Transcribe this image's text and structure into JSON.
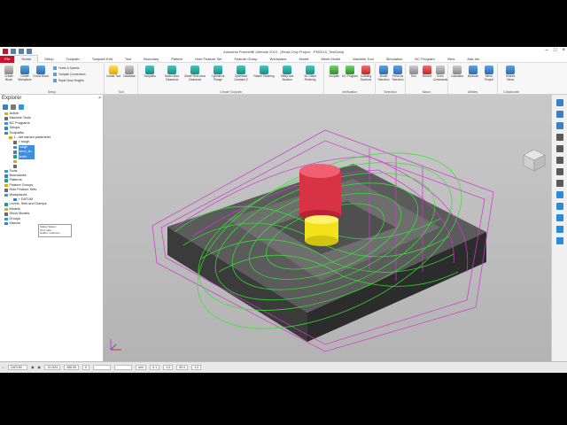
{
  "window": {
    "title": "Autodesk PowerMill Ultimate 2019  - [Read-Only Project - PM2019_TestData]",
    "controls": [
      "–",
      "□",
      "×"
    ]
  },
  "tabs": [
    "File",
    "Home",
    "Setup",
    "Toolpath",
    "Toolpath Edit",
    "Tool",
    "Boundary",
    "Pattern",
    "Hole Feature Set",
    "Feature Group",
    "Workplane",
    "Model",
    "Mesh Model",
    "Machine Tool",
    "Simulation",
    "NC Program",
    "View",
    "Add-Ins"
  ],
  "ribbon": {
    "groups": [
      {
        "label": "Setup",
        "buttons": [
          "Create Block",
          "Create Workplane",
          "Check Block"
        ],
        "small": [
          "Feeds & Speeds",
          "Toolpath Connections",
          "Rapid Move Heights"
        ]
      },
      {
        "label": "Tool",
        "buttons": [
          "Create Tool",
          "Database"
        ]
      },
      {
        "label": "Create Toolpath",
        "buttons": [
          "Toolpaths",
          "Model Area Clearance",
          "Model Rest Area Clearance",
          "Cylindrical Plunge",
          "Optimised Constant Z",
          "Raster Finishing",
          "Steep and Shallow",
          "3D Offset Finishing"
        ]
      },
      {
        "label": "Verification",
        "buttons": [
          "Toolpath",
          "NC Program",
          "Colliding Sections"
        ]
      },
      {
        "label": "Selection",
        "buttons": [
          "Model Selection",
          "Previous Selection"
        ]
      },
      {
        "label": "Macro",
        "buttons": [
          "Run",
          "Record",
          "Echo Commands"
        ]
      },
      {
        "label": "Utilities",
        "buttons": [
          "Calculator",
          "Measure",
          "Mirror Project"
        ]
      },
      {
        "label": "Collaborate",
        "buttons": [
          "Shared Views"
        ]
      }
    ]
  },
  "explorer": {
    "title": "Explorer",
    "items": [
      {
        "label": "Active",
        "indent": 1
      },
      {
        "label": "Machine Tools",
        "indent": 1
      },
      {
        "label": "NC Programs",
        "indent": 1
      },
      {
        "label": "Setups",
        "indent": 1
      },
      {
        "label": "Toolpaths",
        "indent": 1
      },
      {
        "label": "1 - set named parameter",
        "indent": 2
      },
      {
        "label": "> rough",
        "indent": 3
      },
      {
        "label": "rough",
        "indent": 3,
        "selected": true
      },
      {
        "label": "semi_fin",
        "indent": 3,
        "selected": true
      },
      {
        "label": "finish",
        "indent": 3,
        "selected": true
      },
      {
        "label": "",
        "indent": 3
      },
      {
        "label": "",
        "indent": 3
      },
      {
        "label": "Tools",
        "indent": 1
      },
      {
        "label": "Boundaries",
        "indent": 1
      },
      {
        "label": "Patterns",
        "indent": 1
      },
      {
        "label": "Feature Groups",
        "indent": 1
      },
      {
        "label": "Hole Feature Sets",
        "indent": 1
      },
      {
        "label": "Workplanes",
        "indent": 1
      },
      {
        "label": "> DATUM",
        "indent": 3
      },
      {
        "label": "Levels, Sets and Clamps",
        "indent": 1
      },
      {
        "label": "Models",
        "indent": 1
      },
      {
        "label": "Stock Models",
        "indent": 1
      },
      {
        "label": "Groups",
        "indent": 1
      },
      {
        "label": "Macros",
        "indent": 1
      }
    ],
    "tooltip": [
      "Safety Status:",
      "Tool: safe",
      "Holder: unknown"
    ]
  },
  "status": {
    "workplane": "DATUM",
    "fields": [
      "-91.524",
      "286.55",
      "0",
      "",
      "",
      "mm",
      "0.1",
      "1.0",
      "90.0",
      "1.0"
    ]
  },
  "colors": {
    "file_tab": "#c8102e",
    "toolpath": "#33e633",
    "links": "#d633d6",
    "tool_body": "#e03a4a",
    "tool_tip": "#f3e21a",
    "block": "#4a4a4a"
  }
}
